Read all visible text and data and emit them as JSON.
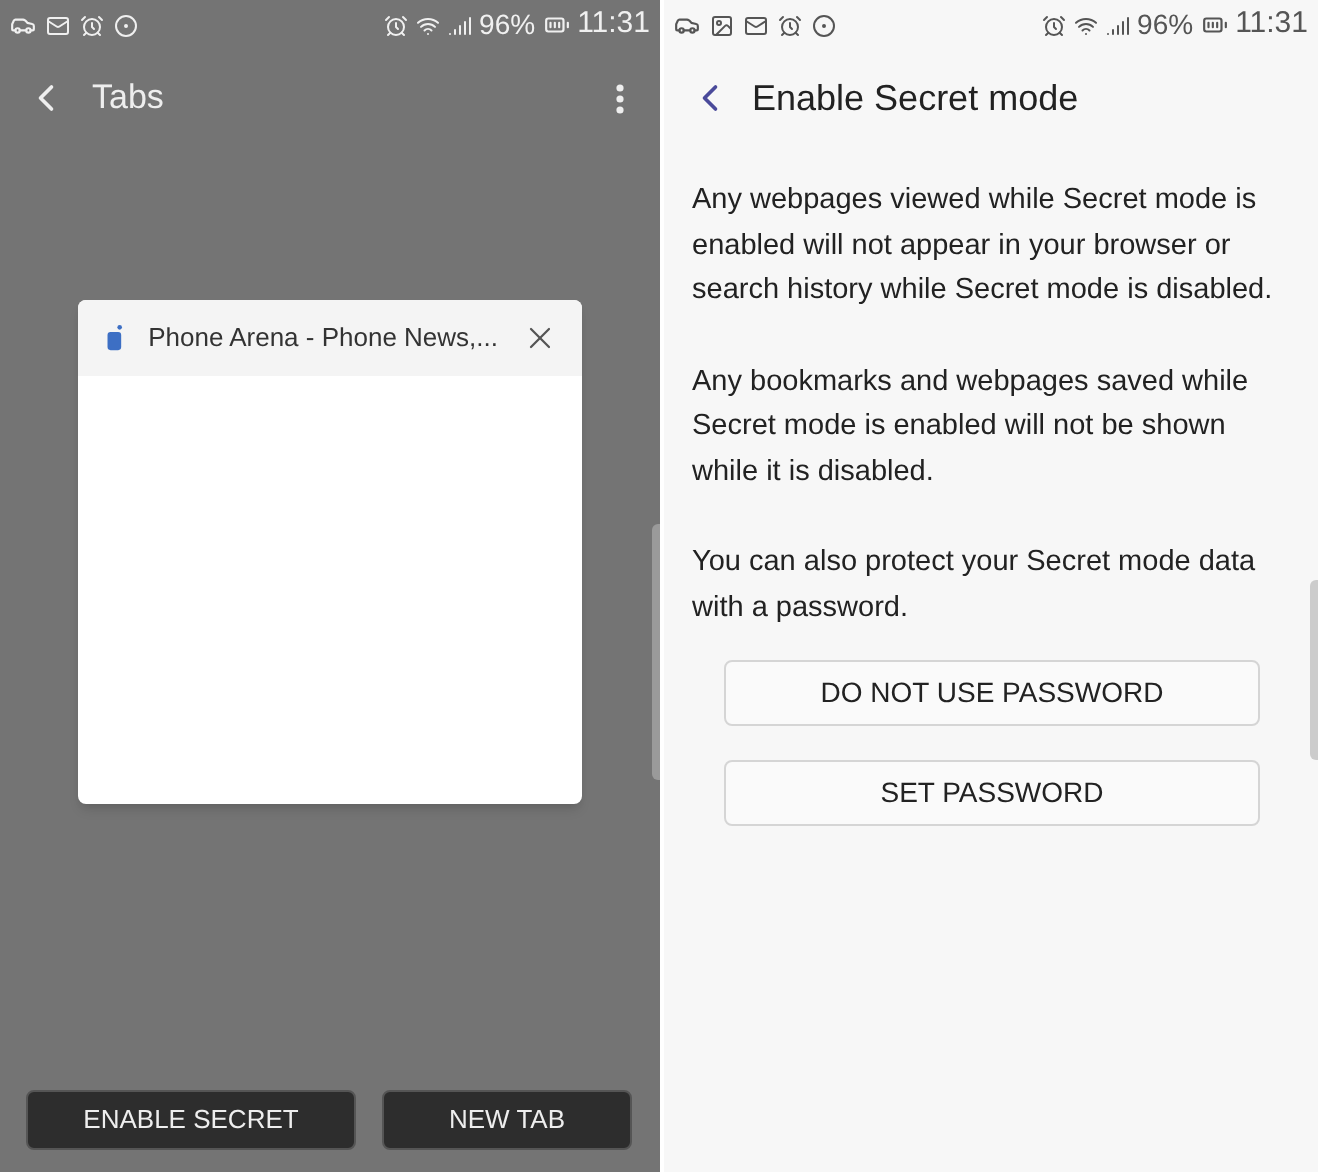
{
  "left_screen": {
    "status_bar": {
      "battery": "96%",
      "time": "11:31"
    },
    "header": {
      "title": "Tabs"
    },
    "tab_card": {
      "title": "Phone Arena - Phone News,..."
    },
    "buttons": [
      "ENABLE SECRET",
      "NEW TAB"
    ]
  },
  "right_screen": {
    "status_bar": {
      "battery": "96%",
      "time": "11:31"
    },
    "header": {
      "title": "Enable Secret mode"
    },
    "paragraphs": [
      "Any webpages viewed while Secret mode is enabled will not appear in your browser or search history while Secret mode is disabled.",
      "Any bookmarks and webpages saved while Secret mode is enabled will not be shown while it is disabled.",
      "You can also protect your Secret mode data with a password."
    ],
    "buttons": [
      "DO NOT USE PASSWORD",
      "SET PASSWORD"
    ]
  }
}
